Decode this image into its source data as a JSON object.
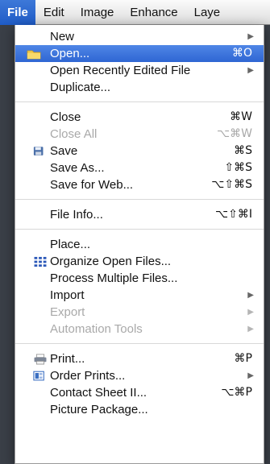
{
  "menubar": {
    "items": [
      "File",
      "Edit",
      "Image",
      "Enhance",
      "Laye"
    ]
  },
  "menu": {
    "new": {
      "label": "New"
    },
    "open": {
      "label": "Open...",
      "shortcut": "⌘O"
    },
    "open_recent": {
      "label": "Open Recently Edited File"
    },
    "duplicate": {
      "label": "Duplicate..."
    },
    "close": {
      "label": "Close",
      "shortcut": "⌘W"
    },
    "close_all": {
      "label": "Close All",
      "shortcut": "⌥⌘W"
    },
    "save": {
      "label": "Save",
      "shortcut": "⌘S"
    },
    "save_as": {
      "label": "Save As...",
      "shortcut": "⇧⌘S"
    },
    "save_web": {
      "label": "Save for Web...",
      "shortcut": "⌥⇧⌘S"
    },
    "file_info": {
      "label": "File Info...",
      "shortcut": "⌥⇧⌘I"
    },
    "place": {
      "label": "Place..."
    },
    "organize": {
      "label": "Organize Open Files..."
    },
    "process": {
      "label": "Process Multiple Files..."
    },
    "import": {
      "label": "Import"
    },
    "export": {
      "label": "Export"
    },
    "automation": {
      "label": "Automation Tools"
    },
    "print": {
      "label": "Print...",
      "shortcut": "⌘P"
    },
    "order_prints": {
      "label": "Order Prints..."
    },
    "contact_sheet": {
      "label": "Contact Sheet II...",
      "shortcut": "⌥⌘P"
    },
    "picture_package": {
      "label": "Picture Package..."
    }
  },
  "icons": {
    "open": "folder-icon",
    "save": "floppy-disk-icon",
    "organize": "grid-icon",
    "print": "printer-icon",
    "order_prints": "order-prints-icon",
    "submenu": "submenu-arrow-icon"
  },
  "colors": {
    "highlight": "#2f66d3",
    "disabled_text": "#a9a9a9"
  }
}
